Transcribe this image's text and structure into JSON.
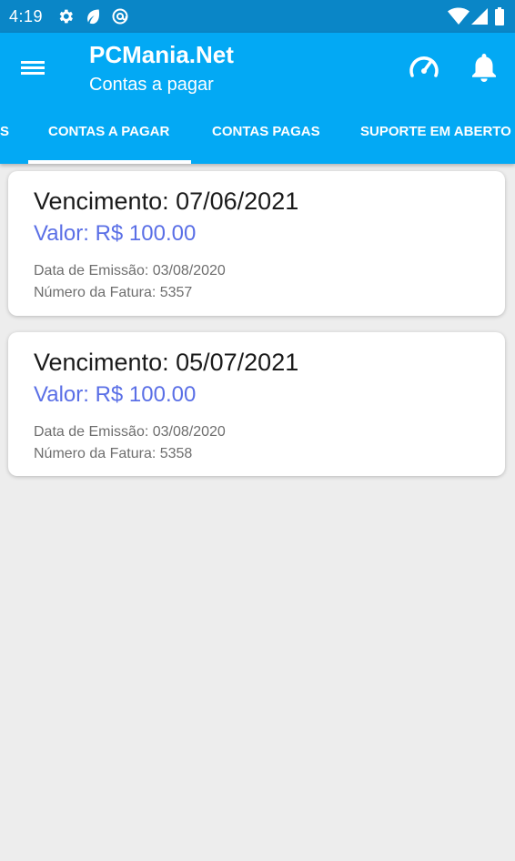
{
  "status_bar": {
    "time": "4:19",
    "left_icons": [
      "settings-icon",
      "leaf-icon",
      "at-sign-icon"
    ],
    "right_icons": [
      "wifi-icon",
      "cell-signal-icon",
      "battery-icon"
    ]
  },
  "header": {
    "title": "PCMania.Net",
    "subtitle": "Contas a pagar",
    "actions": [
      "speedometer-icon",
      "bell-icon"
    ]
  },
  "tabs": {
    "items": [
      {
        "label": "S"
      },
      {
        "label": "CONTAS A PAGAR",
        "selected": true
      },
      {
        "label": "CONTAS PAGAS"
      },
      {
        "label": "SUPORTE EM ABERTO"
      }
    ]
  },
  "invoices": [
    {
      "vencimento": "Vencimento: 07/06/2021",
      "valor": "Valor: R$ 100.00",
      "emissao": "Data de Emissão: 03/08/2020",
      "fatura": "Número da Fatura: 5357"
    },
    {
      "vencimento": "Vencimento: 05/07/2021",
      "valor": "Valor: R$ 100.00",
      "emissao": "Data de Emissão: 03/08/2020",
      "fatura": "Número da Fatura: 5358"
    }
  ],
  "colors": {
    "status_bar": "#0a86c7",
    "app_bar": "#03a9f4",
    "background": "#ededed",
    "valor_text": "#5a6fe6"
  }
}
